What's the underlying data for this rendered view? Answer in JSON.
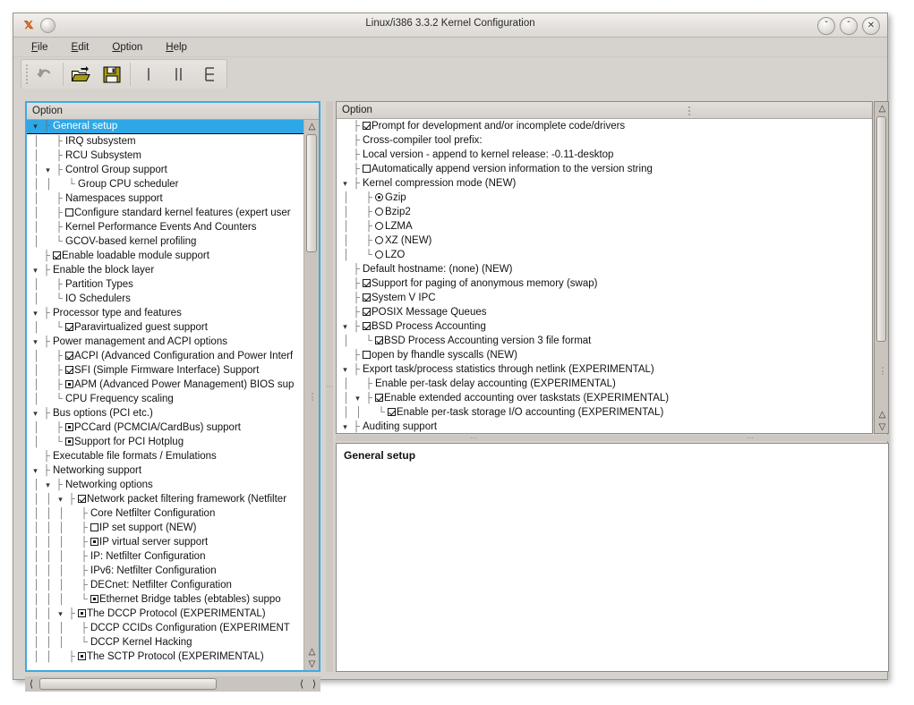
{
  "window": {
    "title": "Linux/i386 3.3.2 Kernel Configuration",
    "app_icon": "x-logo-icon",
    "buttons": {
      "minimize": "ˇ",
      "maximize": "ˆ",
      "close": "✕"
    }
  },
  "menubar": [
    {
      "name": "file",
      "label": "File",
      "accel": "F"
    },
    {
      "name": "edit",
      "label": "Edit",
      "accel": "E"
    },
    {
      "name": "option",
      "label": "Option",
      "accel": "O"
    },
    {
      "name": "help",
      "label": "Help",
      "accel": "H"
    }
  ],
  "toolbar": [
    {
      "name": "back",
      "icon": "undo-arrow-icon",
      "label": "Back"
    },
    {
      "name": "load",
      "icon": "open-folder-icon",
      "label": "Load"
    },
    {
      "name": "save",
      "icon": "floppy-disk-icon",
      "label": "Save"
    },
    {
      "name": "single-view",
      "icon": "single-pane-icon",
      "label": "Single View"
    },
    {
      "name": "split-view",
      "icon": "split-pane-icon",
      "label": "Split View"
    },
    {
      "name": "full-view",
      "icon": "full-pane-icon",
      "label": "Full View"
    }
  ],
  "left_pane": {
    "header": "Option",
    "rows": [
      {
        "depth": 0,
        "twisty": "v",
        "ctrl": "none",
        "label": "General setup",
        "selected": true
      },
      {
        "depth": 1,
        "twisty": "",
        "ctrl": "none",
        "label": "IRQ subsystem"
      },
      {
        "depth": 1,
        "twisty": "",
        "ctrl": "none",
        "label": "RCU Subsystem"
      },
      {
        "depth": 1,
        "twisty": "v",
        "ctrl": "none",
        "label": "Control Group support"
      },
      {
        "depth": 2,
        "twisty": "",
        "ctrl": "none",
        "label": "Group CPU scheduler",
        "last": true
      },
      {
        "depth": 1,
        "twisty": "",
        "ctrl": "none",
        "label": "Namespaces support"
      },
      {
        "depth": 1,
        "twisty": "",
        "ctrl": "unchecked",
        "label": "Configure standard kernel features (expert user"
      },
      {
        "depth": 1,
        "twisty": "",
        "ctrl": "none",
        "label": "Kernel Performance Events And Counters"
      },
      {
        "depth": 1,
        "twisty": "",
        "ctrl": "none",
        "label": "GCOV-based kernel profiling",
        "last": true
      },
      {
        "depth": 0,
        "twisty": "",
        "ctrl": "checked",
        "label": "Enable loadable module support"
      },
      {
        "depth": 0,
        "twisty": "v",
        "ctrl": "none",
        "label": "Enable the block layer"
      },
      {
        "depth": 1,
        "twisty": "",
        "ctrl": "none",
        "label": "Partition Types"
      },
      {
        "depth": 1,
        "twisty": "",
        "ctrl": "none",
        "label": "IO Schedulers",
        "last": true
      },
      {
        "depth": 0,
        "twisty": "v",
        "ctrl": "none",
        "label": "Processor type and features"
      },
      {
        "depth": 1,
        "twisty": "",
        "ctrl": "checked",
        "label": "Paravirtualized guest support",
        "last": true
      },
      {
        "depth": 0,
        "twisty": "v",
        "ctrl": "none",
        "label": "Power management and ACPI options"
      },
      {
        "depth": 1,
        "twisty": "",
        "ctrl": "checked",
        "label": "ACPI (Advanced Configuration and Power Interf"
      },
      {
        "depth": 1,
        "twisty": "",
        "ctrl": "checked",
        "label": "SFI (Simple Firmware Interface) Support"
      },
      {
        "depth": 1,
        "twisty": "",
        "ctrl": "dotted",
        "label": "APM (Advanced Power Management) BIOS sup"
      },
      {
        "depth": 1,
        "twisty": "",
        "ctrl": "none",
        "label": "CPU Frequency scaling",
        "last": true
      },
      {
        "depth": 0,
        "twisty": "v",
        "ctrl": "none",
        "label": "Bus options (PCI etc.)"
      },
      {
        "depth": 1,
        "twisty": "",
        "ctrl": "dotted",
        "label": "PCCard (PCMCIA/CardBus) support"
      },
      {
        "depth": 1,
        "twisty": "",
        "ctrl": "dotted",
        "label": "Support for PCI Hotplug",
        "last": true
      },
      {
        "depth": 0,
        "twisty": "",
        "ctrl": "none",
        "label": "Executable file formats / Emulations"
      },
      {
        "depth": 0,
        "twisty": "v",
        "ctrl": "none",
        "label": "Networking support"
      },
      {
        "depth": 1,
        "twisty": "v",
        "ctrl": "none",
        "label": "Networking options"
      },
      {
        "depth": 2,
        "twisty": "v",
        "ctrl": "checked",
        "label": "Network packet filtering framework (Netfilter"
      },
      {
        "depth": 3,
        "twisty": "",
        "ctrl": "none",
        "label": "Core Netfilter Configuration"
      },
      {
        "depth": 3,
        "twisty": "",
        "ctrl": "unchecked",
        "label": "IP set support (NEW)"
      },
      {
        "depth": 3,
        "twisty": "",
        "ctrl": "dotted",
        "label": "IP virtual server support"
      },
      {
        "depth": 3,
        "twisty": "",
        "ctrl": "none",
        "label": "IP: Netfilter Configuration"
      },
      {
        "depth": 3,
        "twisty": "",
        "ctrl": "none",
        "label": "IPv6: Netfilter Configuration"
      },
      {
        "depth": 3,
        "twisty": "",
        "ctrl": "none",
        "label": "DECnet: Netfilter Configuration"
      },
      {
        "depth": 3,
        "twisty": "",
        "ctrl": "dotted",
        "label": "Ethernet Bridge tables (ebtables) suppo",
        "last": true
      },
      {
        "depth": 2,
        "twisty": "v",
        "ctrl": "dotted",
        "label": "The DCCP Protocol (EXPERIMENTAL)"
      },
      {
        "depth": 3,
        "twisty": "",
        "ctrl": "none",
        "label": "DCCP CCIDs Configuration (EXPERIMENT"
      },
      {
        "depth": 3,
        "twisty": "",
        "ctrl": "none",
        "label": "DCCP Kernel Hacking",
        "last": true
      },
      {
        "depth": 2,
        "twisty": "",
        "ctrl": "dotted",
        "label": "The SCTP Protocol (EXPERIMENTAL)"
      }
    ]
  },
  "right_pane": {
    "header": "Option",
    "rows": [
      {
        "depth": 0,
        "twisty": "",
        "ctrl": "checked",
        "label": "Prompt for development and/or incomplete code/drivers"
      },
      {
        "depth": 0,
        "twisty": "",
        "ctrl": "none",
        "label": "Cross-compiler tool prefix:"
      },
      {
        "depth": 0,
        "twisty": "",
        "ctrl": "none",
        "label": "Local version - append to kernel release: -0.11-desktop"
      },
      {
        "depth": 0,
        "twisty": "",
        "ctrl": "unchecked",
        "label": "Automatically append version information to the version string"
      },
      {
        "depth": 0,
        "twisty": "v",
        "ctrl": "none",
        "label": "Kernel compression mode (NEW)"
      },
      {
        "depth": 1,
        "twisty": "",
        "ctrl": "radio-on",
        "label": "Gzip"
      },
      {
        "depth": 1,
        "twisty": "",
        "ctrl": "radio-off",
        "label": "Bzip2"
      },
      {
        "depth": 1,
        "twisty": "",
        "ctrl": "radio-off",
        "label": "LZMA"
      },
      {
        "depth": 1,
        "twisty": "",
        "ctrl": "radio-off",
        "label": "XZ (NEW)"
      },
      {
        "depth": 1,
        "twisty": "",
        "ctrl": "radio-off",
        "label": "LZO",
        "last": true
      },
      {
        "depth": 0,
        "twisty": "",
        "ctrl": "none",
        "label": "Default hostname: (none) (NEW)"
      },
      {
        "depth": 0,
        "twisty": "",
        "ctrl": "checked",
        "label": "Support for paging of anonymous memory (swap)"
      },
      {
        "depth": 0,
        "twisty": "",
        "ctrl": "checked",
        "label": "System V IPC"
      },
      {
        "depth": 0,
        "twisty": "",
        "ctrl": "checked",
        "label": "POSIX Message Queues"
      },
      {
        "depth": 0,
        "twisty": "v",
        "ctrl": "checked",
        "label": "BSD Process Accounting"
      },
      {
        "depth": 1,
        "twisty": "",
        "ctrl": "checked",
        "label": "BSD Process Accounting version 3 file format",
        "last": true
      },
      {
        "depth": 0,
        "twisty": "",
        "ctrl": "unchecked",
        "label": "open by fhandle syscalls (NEW)"
      },
      {
        "depth": 0,
        "twisty": "v",
        "ctrl": "none",
        "label": "Export task/process statistics through netlink (EXPERIMENTAL)"
      },
      {
        "depth": 1,
        "twisty": "",
        "ctrl": "none",
        "label": "Enable per-task delay accounting (EXPERIMENTAL)"
      },
      {
        "depth": 1,
        "twisty": "v",
        "ctrl": "checked",
        "label": "Enable extended accounting over taskstats (EXPERIMENTAL)"
      },
      {
        "depth": 2,
        "twisty": "",
        "ctrl": "checked",
        "label": "Enable per-task storage I/O accounting (EXPERIMENTAL)",
        "last": true
      },
      {
        "depth": 0,
        "twisty": "v",
        "ctrl": "none",
        "label": "Auditing support"
      }
    ]
  },
  "detail_pane": {
    "title": "General setup",
    "body": ""
  },
  "colors": {
    "selection": "#2ea7e6",
    "focus_border": "#3fa9e0",
    "window_bg": "#d6d2cd",
    "pane_bg": "#ffffff"
  }
}
